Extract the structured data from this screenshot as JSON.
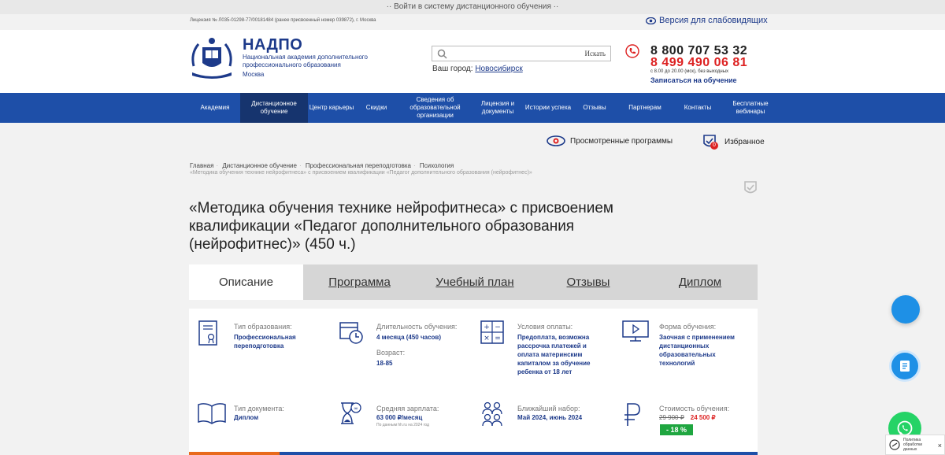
{
  "topbar": {
    "text": "·· Войти в систему дистанционного обучения ··"
  },
  "licbar": {
    "license": "Лицензия № Л035-01298-77/00181484 (ранее присвоенный номер 039872), г. Москва",
    "visually_impaired": "Версия для слабовидящих"
  },
  "header": {
    "logo_title": "НАДПО",
    "logo_subtitle": "Национальная академия дополнительного профессионального образования",
    "logo_city": "Москва",
    "search_button": "Искать",
    "search_placeholder": "",
    "city_label": "Ваш город:",
    "city_value": "Новосибирск",
    "phone1": "8 800 707 53 32",
    "phone2": "8 499 490 06 81",
    "hours": "с 8.00 до 20.00 (мск), без выходных",
    "signup": "Записаться на обучение"
  },
  "nav": {
    "items": [
      "Академия",
      "Дистанционное обучение",
      "Центр карьеры",
      "Скидки",
      "Сведения об образовательной организации",
      "Лицензия и документы",
      "Истории успеха",
      "Отзывы",
      "Партнерам",
      "Контакты",
      "Бесплатные вебинары"
    ]
  },
  "tools": {
    "viewed": "Просмотренные программы",
    "favorites": "Избранное",
    "favorites_count": "0"
  },
  "breadcrumbs": {
    "items": [
      "Главная",
      "Дистанционное обучение",
      "Профессиональная переподготовка",
      "Психология"
    ],
    "current": "«Методика обучения технике нейрофитнеса» с присвоением квалификации «Педагог дополнительного образования (нейрофитнес)»"
  },
  "course": {
    "title": "«Методика обучения технике нейрофитнеса» с присвоением квалификации «Педагог дополнительного образования (нейрофитнес)» (450 ч.)"
  },
  "tabs": [
    "Описание",
    "Программа",
    "Учебный план",
    "Отзывы",
    "Диплом"
  ],
  "details": {
    "edu_type_label": "Тип образования:",
    "edu_type_value": "Профессиональная переподготовка",
    "duration_label": "Длительность обучения:",
    "duration_value": "4 месяца (450 часов)",
    "age_label": "Возраст:",
    "age_value": "18-85",
    "payment_label": "Условия оплаты:",
    "payment_value": "Предоплата, возможна рассрочка платежей и оплата материнским капиталом за обучение ребенка от 18 лет",
    "form_label": "Форма обучения:",
    "form_value": "Заочная с применением дистанционных образовательных технологий",
    "doc_label": "Тип документа:",
    "doc_value": "Диплом",
    "salary_label": "Средняя зарплата:",
    "salary_value": "63 000 ₽/месяц",
    "salary_source": "По данным hh.ru на 2024 год",
    "intake_label": "Ближайший набор:",
    "intake_value": "Май 2024, июнь 2024",
    "price_label": "Стоимость обучения:",
    "price_old": "29 900 ₽",
    "price_new": "24 500 ₽",
    "discount": "- 18 %"
  },
  "cookie": {
    "text": "Политика обработки данных",
    "close": "×"
  },
  "colors": {
    "brand_blue": "#1e4fa8",
    "dark_blue": "#16346e",
    "accent_red": "#dd2222",
    "discount_green": "#1fa640"
  }
}
